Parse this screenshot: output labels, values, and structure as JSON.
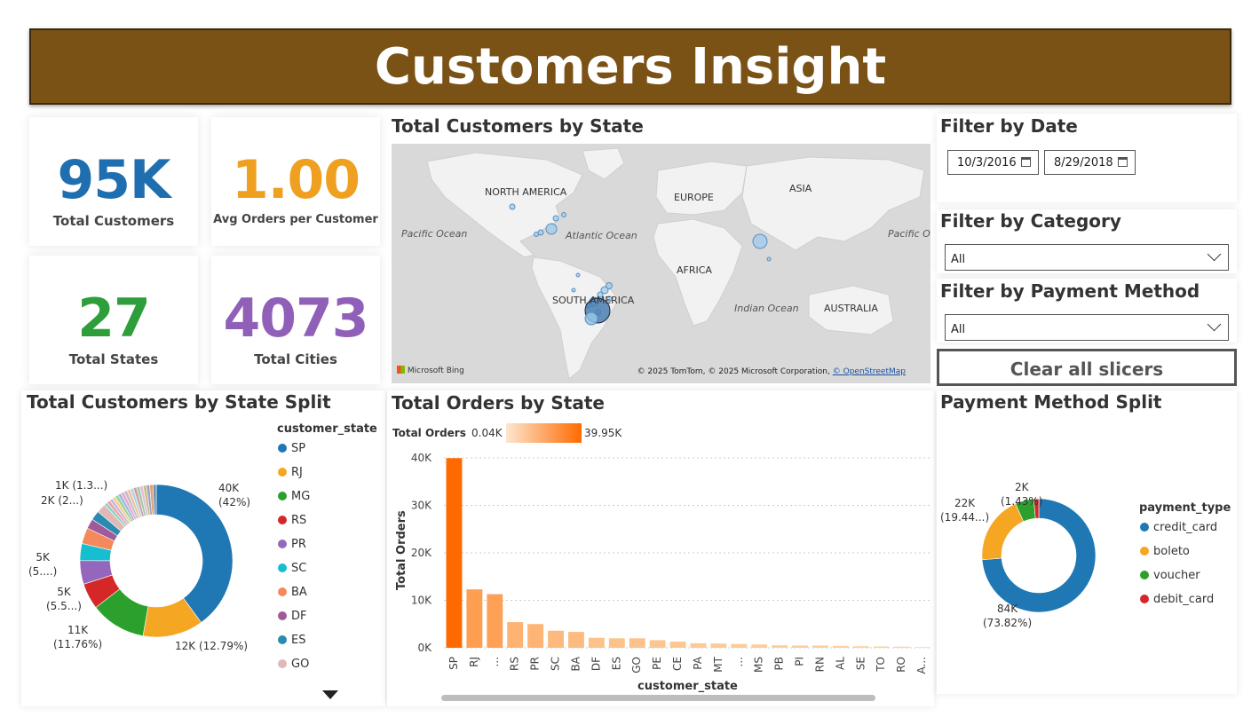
{
  "header": {
    "title": "Customers Insight"
  },
  "kpis": [
    {
      "value": "95K",
      "label": "Total Customers",
      "color": "#1f6fb0"
    },
    {
      "value": "1.00",
      "label": "Avg Orders per Customer",
      "color": "#f0a020"
    },
    {
      "value": "27",
      "label": "Total States",
      "color": "#2e9e3a"
    },
    {
      "value": "4073",
      "label": "Total Cities",
      "color": "#9060b8"
    }
  ],
  "map": {
    "title": "Total Customers by State",
    "continents": [
      "NORTH AMERICA",
      "EUROPE",
      "ASIA",
      "AFRICA",
      "SOUTH AMERICA",
      "AUSTRALIA"
    ],
    "oceans": [
      "Pacific Ocean",
      "Atlantic Ocean",
      "Indian Ocean",
      "Pacific Oc"
    ],
    "attribution": "© 2025 TomTom, © 2025 Microsoft Corporation,",
    "attribution_link": "© OpenStreetMap",
    "bing_label": "Microsoft Bing"
  },
  "filters": {
    "date_title": "Filter by Date",
    "date_start": "10/3/2016",
    "date_end": "8/29/2018",
    "category_title": "Filter by Category",
    "category_value": "All",
    "payment_title": "Filter by Payment Method",
    "payment_value": "All",
    "clear_label": "Clear all slicers"
  },
  "chart_data": [
    {
      "type": "pie",
      "title": "Total Customers by State Split",
      "legend_title": "customer_state",
      "legend_placement": "right",
      "categories": [
        "SP",
        "RJ",
        "MG",
        "RS",
        "PR",
        "SC",
        "BA",
        "DF",
        "ES",
        "GO"
      ],
      "values": [
        40,
        12.79,
        11.76,
        5.5,
        5,
        3.6,
        3.4,
        2.1,
        2.0,
        2.0
      ],
      "colors": [
        "#1f77b4",
        "#f5a623",
        "#2ca02c",
        "#d62728",
        "#9467bd",
        "#17becf",
        "#f48a5c",
        "#a05a9a",
        "#2a8ab0",
        "#e0b8b8"
      ],
      "labels": [
        {
          "line1": "40K",
          "line2": "(42%)"
        },
        {
          "line1": "12K (12.79%)",
          "line2": ""
        },
        {
          "line1": "11K",
          "line2": "(11.76%)"
        },
        {
          "line1": "5K",
          "line2": "(5.5...)"
        },
        {
          "line1": "5K",
          "line2": "(5....)"
        },
        {
          "line1": "2K (2...)",
          "line2": ""
        },
        {
          "line1": "1K (1.3...)",
          "line2": ""
        }
      ]
    },
    {
      "type": "bar",
      "title": "Total Orders by State",
      "legend_title": "Total Orders",
      "legend_min": "0.04K",
      "legend_max": "39.95K",
      "xlabel": "customer_state",
      "ylabel": "Total Orders",
      "ylim": [
        0,
        40000
      ],
      "yticks": [
        "0K",
        "10K",
        "20K",
        "30K",
        "40K"
      ],
      "categories": [
        "SP",
        "RJ",
        "...",
        "RS",
        "PR",
        "SC",
        "BA",
        "DF",
        "ES",
        "GO",
        "PE",
        "CE",
        "PA",
        "MT",
        "...",
        "MS",
        "PB",
        "PI",
        "RN",
        "AL",
        "SE",
        "TO",
        "RO",
        "A..."
      ],
      "values": [
        39950,
        12300,
        11300,
        5400,
        5000,
        3600,
        3350,
        2100,
        2000,
        2000,
        1600,
        1300,
        950,
        900,
        800,
        700,
        530,
        490,
        470,
        400,
        340,
        280,
        240,
        150
      ]
    },
    {
      "type": "pie",
      "title": "Payment Method Split",
      "legend_title": "payment_type",
      "legend_placement": "right",
      "categories": [
        "credit_card",
        "boleto",
        "voucher",
        "debit_card"
      ],
      "values": [
        73.82,
        19.44,
        5.31,
        1.43
      ],
      "colors": [
        "#1f77b4",
        "#f5a623",
        "#2ca02c",
        "#d62728"
      ],
      "labels": [
        {
          "line1": "84K",
          "line2": "(73.82%)"
        },
        {
          "line1": "22K",
          "line2": "(19.44...)"
        },
        {
          "line1": "2K",
          "line2": "(1.43%)"
        }
      ]
    }
  ]
}
